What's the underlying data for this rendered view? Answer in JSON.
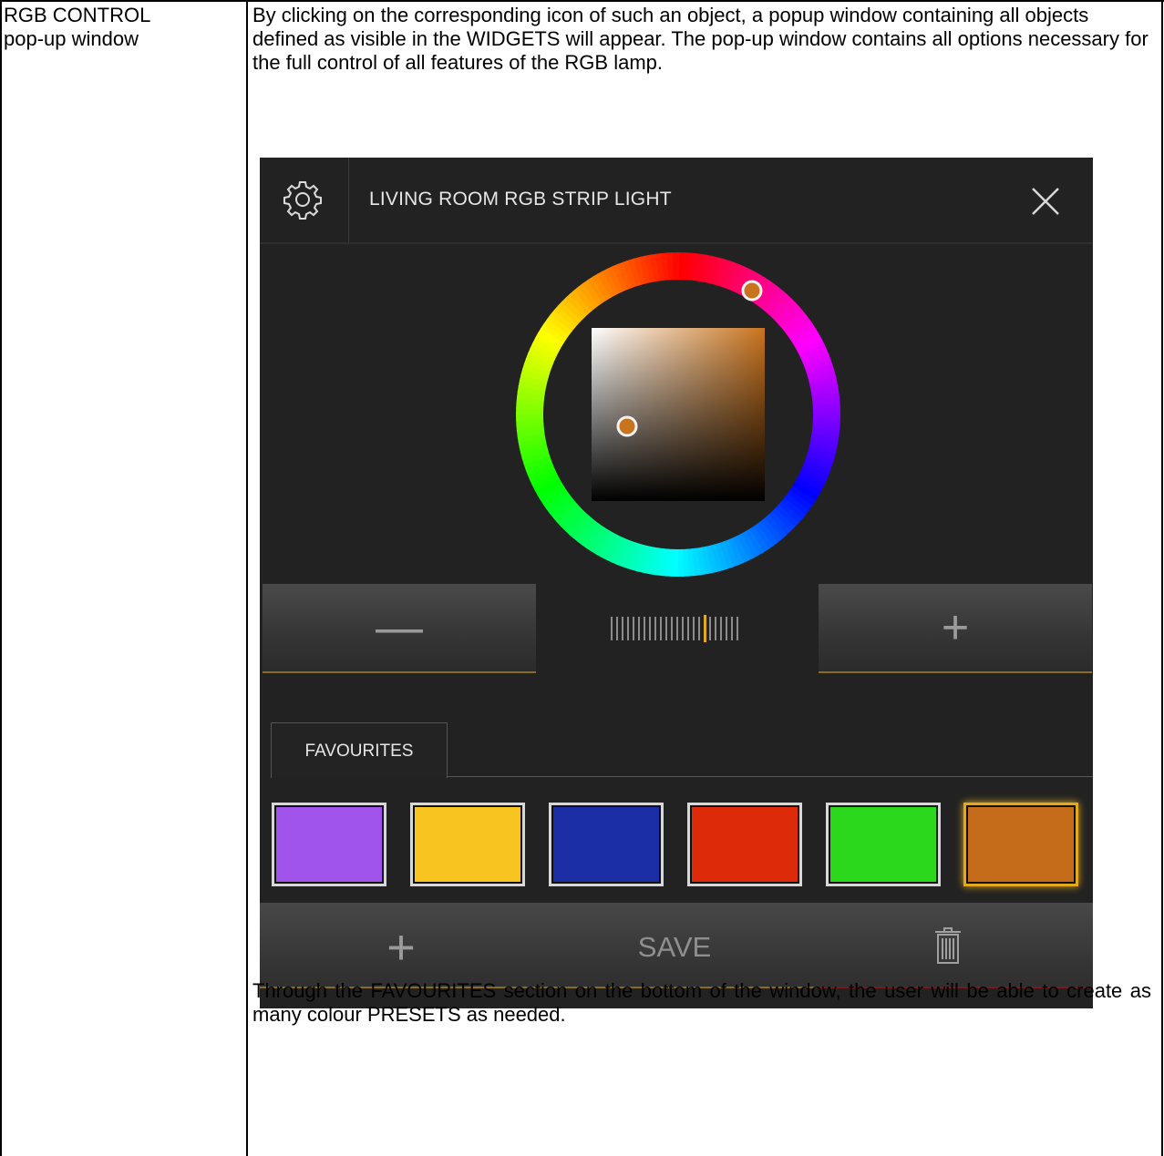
{
  "left_cell": {
    "line1": "RGB CONTROL",
    "line2": "pop-up window"
  },
  "intro_text": "By clicking on the corresponding icon of such an object, a popup window containing all objects defined as visible in the WIDGETS will appear.  The pop-up window contains all options necessary for the full control of all features of the RGB lamp.",
  "outro_text": "Through the FAVOURITES section on the bottom of the window, the user will be able to create as many colour PRESETS as needed.",
  "popup": {
    "title": "LIVING ROOM RGB STRIP LIGHT",
    "icons": {
      "settings": "gear-icon",
      "close": "close-icon",
      "add": "plus-icon",
      "delete": "trash-icon"
    },
    "brightness": {
      "minus_label": "—",
      "plus_label": "+",
      "level": 0.73
    },
    "selected_color": "#c8731e",
    "favourites": {
      "tab_label": "FAVOURITES",
      "swatches": [
        "#a154ec",
        "#f8c420",
        "#1b2ea6",
        "#dd2a08",
        "#2bd81b",
        "#c56c1a"
      ],
      "selected_index": 5
    },
    "actions": {
      "add_label": "+",
      "save_label": "SAVE"
    },
    "colors": {
      "background": "#222222",
      "accent": "#e2a91c",
      "danger": "#7a1a1a"
    }
  }
}
